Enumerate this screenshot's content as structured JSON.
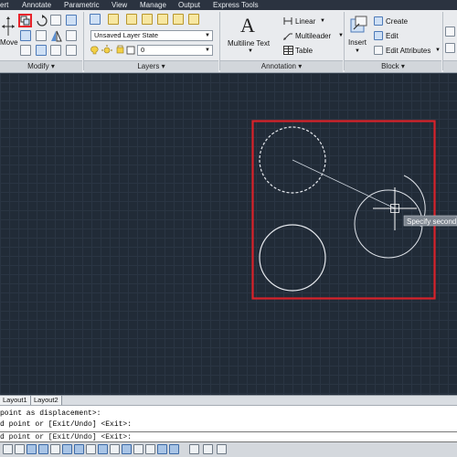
{
  "menubar": {
    "items": [
      "ert",
      "Annotate",
      "Parametric",
      "View",
      "Manage",
      "Output",
      "Express Tools"
    ]
  },
  "ribbon": {
    "modify": {
      "move_label": "Move",
      "panel_label": "Modify",
      "panel_arrow": "▾"
    },
    "layers": {
      "layer_state_value": "Unsaved Layer State",
      "layer_value": "0",
      "panel_label": "Layers",
      "panel_arrow": "▾"
    },
    "annotation": {
      "big_letter": "A",
      "multiline_text_label": "Multiline Text",
      "linear_label": "Linear",
      "multileader_label": "Multileader",
      "table_label": "Table",
      "panel_label": "Annotation",
      "panel_arrow": "▾"
    },
    "block": {
      "insert_label": "Insert",
      "create_label": "Create",
      "edit_label": "Edit",
      "edit_attributes_label": "Edit Attributes",
      "panel_label": "Block",
      "panel_arrow": "▾"
    },
    "highlight_color": "#e8232b"
  },
  "canvas": {
    "tooltip_text": "Specify second",
    "selection_color": "#d9222a",
    "background_color": "#212b37"
  },
  "tabs": [
    "Layout1",
    "Layout2"
  ],
  "command": {
    "history": [
      "point as displacement>:",
      "d point or [Exit/Undo] <Exit>:"
    ],
    "current": "d point or [Exit/Undo] <Exit>:"
  }
}
